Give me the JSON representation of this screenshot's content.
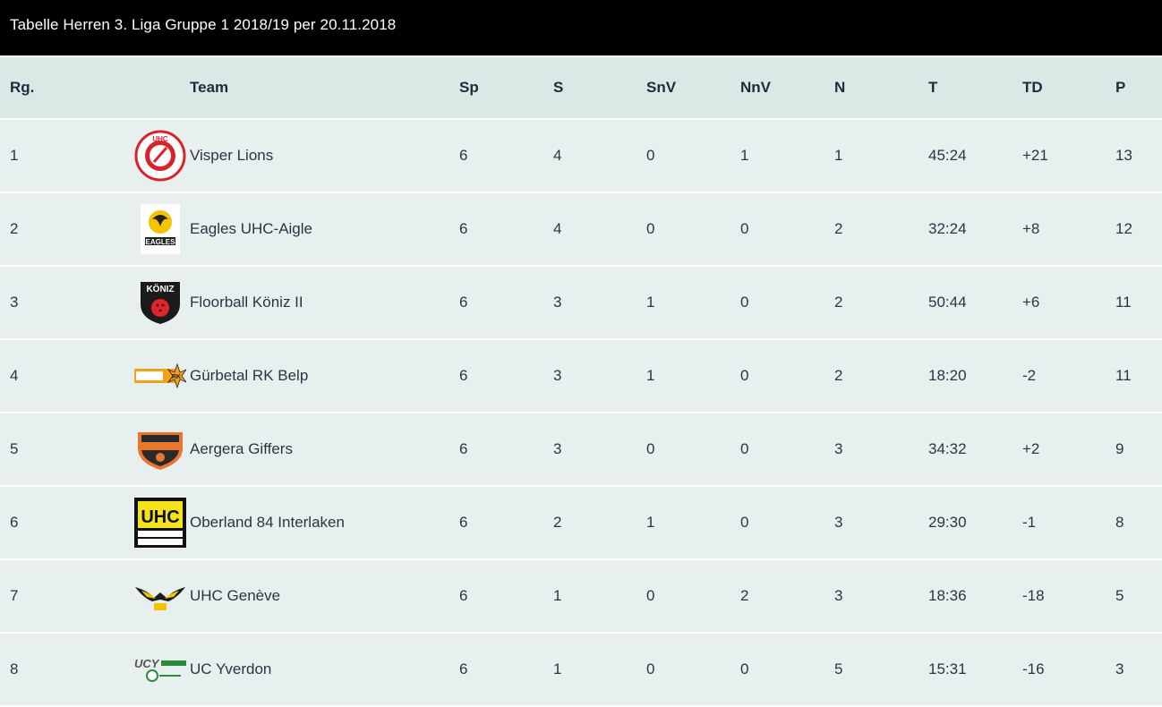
{
  "title": "Tabelle Herren 3. Liga Gruppe 1 2018/19 per 20.11.2018",
  "columns": {
    "rank": "Rg.",
    "team": "Team",
    "sp": "Sp",
    "s": "S",
    "snv": "SnV",
    "nnv": "NnV",
    "n": "N",
    "t": "T",
    "td": "TD",
    "p": "P"
  },
  "rows": [
    {
      "rank": "1",
      "team": "Visper Lions",
      "logo": "visper-lions-logo",
      "sp": "6",
      "s": "4",
      "snv": "0",
      "nnv": "1",
      "n": "1",
      "t": "45:24",
      "td": "+21",
      "p": "13"
    },
    {
      "rank": "2",
      "team": "Eagles UHC-Aigle",
      "logo": "eagles-aigle-logo",
      "sp": "6",
      "s": "4",
      "snv": "0",
      "nnv": "0",
      "n": "2",
      "t": "32:24",
      "td": "+8",
      "p": "12"
    },
    {
      "rank": "3",
      "team": "Floorball Köniz II",
      "logo": "koniz-logo",
      "sp": "6",
      "s": "3",
      "snv": "1",
      "nnv": "0",
      "n": "2",
      "t": "50:44",
      "td": "+6",
      "p": "11"
    },
    {
      "rank": "4",
      "team": "Gürbetal RK Belp",
      "logo": "gurbetal-logo",
      "sp": "6",
      "s": "3",
      "snv": "1",
      "nnv": "0",
      "n": "2",
      "t": "18:20",
      "td": "-2",
      "p": "11"
    },
    {
      "rank": "5",
      "team": "Aergera Giffers",
      "logo": "aergera-logo",
      "sp": "6",
      "s": "3",
      "snv": "0",
      "nnv": "0",
      "n": "3",
      "t": "34:32",
      "td": "+2",
      "p": "9"
    },
    {
      "rank": "6",
      "team": "Oberland 84 Interlaken",
      "logo": "oberland-logo",
      "sp": "6",
      "s": "2",
      "snv": "1",
      "nnv": "0",
      "n": "3",
      "t": "29:30",
      "td": "-1",
      "p": "8"
    },
    {
      "rank": "7",
      "team": "UHC Genève",
      "logo": "geneve-logo",
      "sp": "6",
      "s": "1",
      "snv": "0",
      "nnv": "2",
      "n": "3",
      "t": "18:36",
      "td": "-18",
      "p": "5"
    },
    {
      "rank": "8",
      "team": "UC Yverdon",
      "logo": "yverdon-logo",
      "sp": "6",
      "s": "1",
      "snv": "0",
      "nnv": "0",
      "n": "5",
      "t": "15:31",
      "td": "-16",
      "p": "3"
    }
  ],
  "colors": {
    "title_bg": "#000000",
    "header_bg": "#dbe8e5",
    "row_bg": "#e8f0ef"
  }
}
